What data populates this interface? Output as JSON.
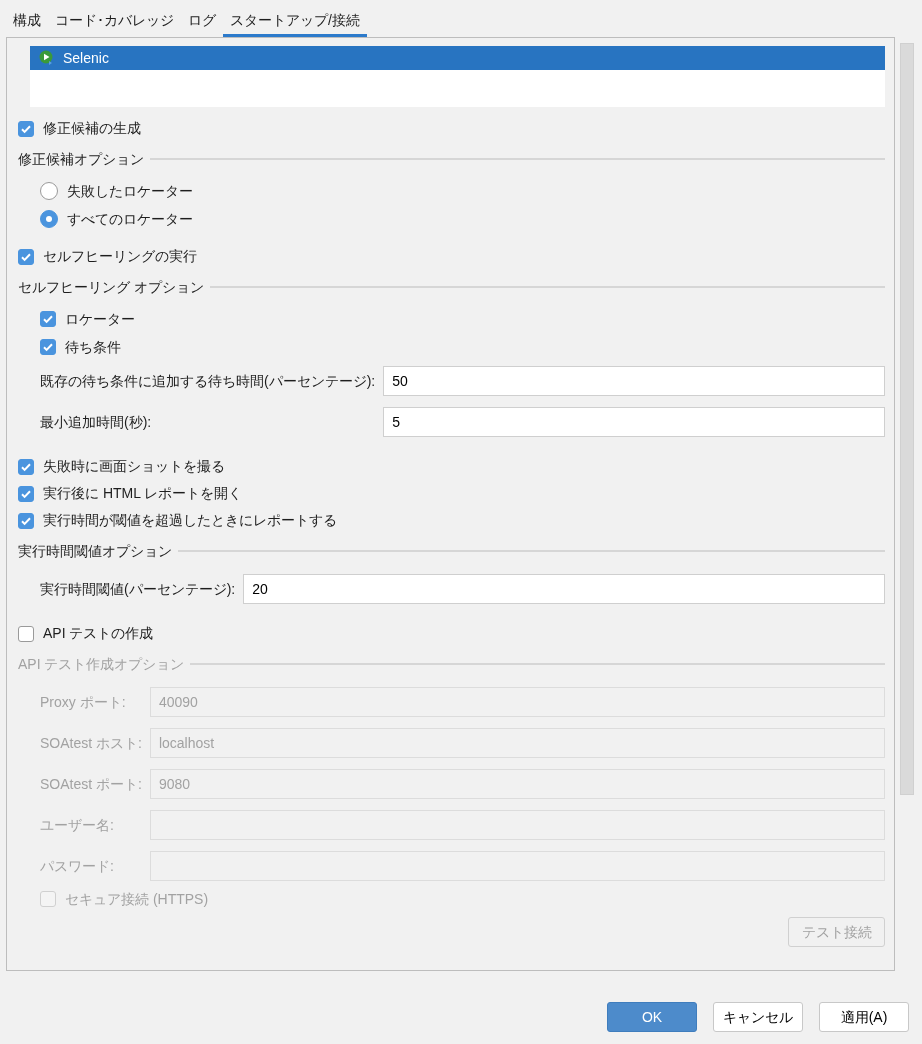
{
  "tabs": [
    {
      "label": "構成",
      "selected": false
    },
    {
      "label": "コード･カバレッジ",
      "selected": false
    },
    {
      "label": "ログ",
      "selected": false
    },
    {
      "label": "スタートアップ/接続",
      "selected": true
    }
  ],
  "launcher_list": [
    {
      "label": "Selenic",
      "selected": true
    }
  ],
  "options": [
    {
      "kind": "checkbox",
      "label": "修正候補の生成",
      "checked": true,
      "disabled": false
    },
    {
      "kind": "group",
      "title": "修正候補オプション",
      "disabled": false,
      "children": [
        {
          "kind": "radio",
          "label": "失敗したロケーター",
          "selected": false,
          "disabled": false
        },
        {
          "kind": "radio",
          "label": "すべてのロケーター",
          "selected": true,
          "disabled": false
        }
      ]
    },
    {
      "kind": "checkbox",
      "label": "セルフヒーリングの実行",
      "checked": true,
      "disabled": false
    },
    {
      "kind": "group",
      "title": "セルフヒーリング オプション",
      "disabled": false,
      "children": [
        {
          "kind": "checkbox",
          "label": "ロケーター",
          "checked": true,
          "disabled": false
        },
        {
          "kind": "checkbox",
          "label": "待ち条件",
          "checked": true,
          "disabled": false
        },
        {
          "kind": "field",
          "label": "既存の待ち条件に追加する待ち時間(パーセンテージ):",
          "value": "50",
          "disabled": false
        },
        {
          "kind": "field",
          "label": "最小追加時間(秒):",
          "value": "5",
          "disabled": false
        }
      ]
    },
    {
      "kind": "checkbox",
      "label": "失敗時に画面ショットを撮る",
      "checked": true,
      "disabled": false
    },
    {
      "kind": "checkbox",
      "label": "実行後に HTML レポートを開く",
      "checked": true,
      "disabled": false
    },
    {
      "kind": "checkbox",
      "label": "実行時間が閾値を超過したときにレポートする",
      "checked": true,
      "disabled": false
    },
    {
      "kind": "group",
      "title": "実行時間閾値オプション",
      "disabled": false,
      "children": [
        {
          "kind": "field",
          "label": "実行時間閾値(パーセンテージ):",
          "value": "20",
          "disabled": false
        }
      ]
    },
    {
      "kind": "checkbox",
      "label": "API テストの作成",
      "checked": false,
      "disabled": false
    },
    {
      "kind": "group",
      "title": "API テスト作成オプション",
      "disabled": true,
      "children": [
        {
          "kind": "field",
          "label": "Proxy ポート:",
          "value": "40090",
          "disabled": true
        },
        {
          "kind": "field",
          "label": "SOAtest ホスト:",
          "value": "localhost",
          "disabled": true
        },
        {
          "kind": "field",
          "label": "SOAtest ポート:",
          "value": "9080",
          "disabled": true
        },
        {
          "kind": "field",
          "label": "ユーザー名:",
          "disabled": true
        },
        {
          "kind": "field",
          "label": "パスワード:",
          "disabled": true
        },
        {
          "kind": "checkbox",
          "label": "セキュア接続 (HTTPS)",
          "checked": false,
          "disabled": true
        },
        {
          "kind": "button",
          "label": "テスト接続",
          "disabled": true
        }
      ]
    }
  ],
  "dialog_buttons": [
    {
      "label": "OK",
      "primary": true
    },
    {
      "label": "キャンセル",
      "primary": false
    },
    {
      "label": "適用(A)",
      "primary": false
    }
  ]
}
